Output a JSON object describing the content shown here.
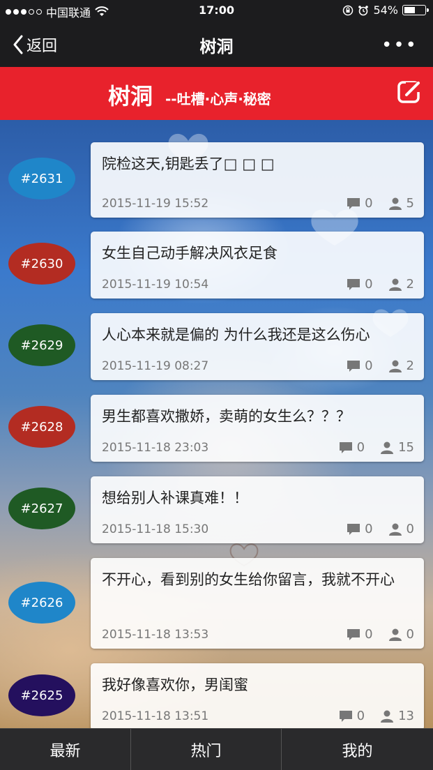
{
  "status": {
    "carrier": "中国联通",
    "time": "17:00",
    "battery_text": "54%",
    "battery_level": 0.54
  },
  "nav": {
    "back_label": "返回",
    "title": "树洞",
    "more_label": "•••"
  },
  "banner": {
    "title": "树洞",
    "subtitle": "--吐槽·心声·秘密"
  },
  "posts": [
    {
      "id": "#2631",
      "text": "院检这天,钥匙丢了□ □ □",
      "date": "2015-11-19 15:52",
      "comments": "0",
      "users": "5",
      "badge_color": "#1f86c9"
    },
    {
      "id": "#2630",
      "text": "女生自己动手解决风衣足食",
      "date": "2015-11-19 10:54",
      "comments": "0",
      "users": "2",
      "badge_color": "#b32c22"
    },
    {
      "id": "#2629",
      "text": "人心本来就是偏的 为什么我还是这么伤心",
      "date": "2015-11-19 08:27",
      "comments": "0",
      "users": "2",
      "badge_color": "#1f5a24"
    },
    {
      "id": "#2628",
      "text": "男生都喜欢撒娇，卖萌的女生么？？？",
      "date": "2015-11-18 23:03",
      "comments": "0",
      "users": "15",
      "badge_color": "#b32c22"
    },
    {
      "id": "#2627",
      "text": "想给别人补课真难！！",
      "date": "2015-11-18 15:30",
      "comments": "0",
      "users": "0",
      "badge_color": "#1f5a24"
    },
    {
      "id": "#2626",
      "text": "不开心，看到别的女生给你留言，我就不开心",
      "date": "2015-11-18 13:53",
      "comments": "0",
      "users": "0",
      "badge_color": "#1f86c9"
    },
    {
      "id": "#2625",
      "text": "我好像喜欢你，男闺蜜",
      "date": "2015-11-18 13:51",
      "comments": "0",
      "users": "13",
      "badge_color": "#24105e"
    }
  ],
  "tabs": [
    {
      "label": "最新"
    },
    {
      "label": "热门"
    },
    {
      "label": "我的"
    }
  ],
  "colors": {
    "banner_red": "#e8222c",
    "bar_dark": "#1c1c1e"
  }
}
